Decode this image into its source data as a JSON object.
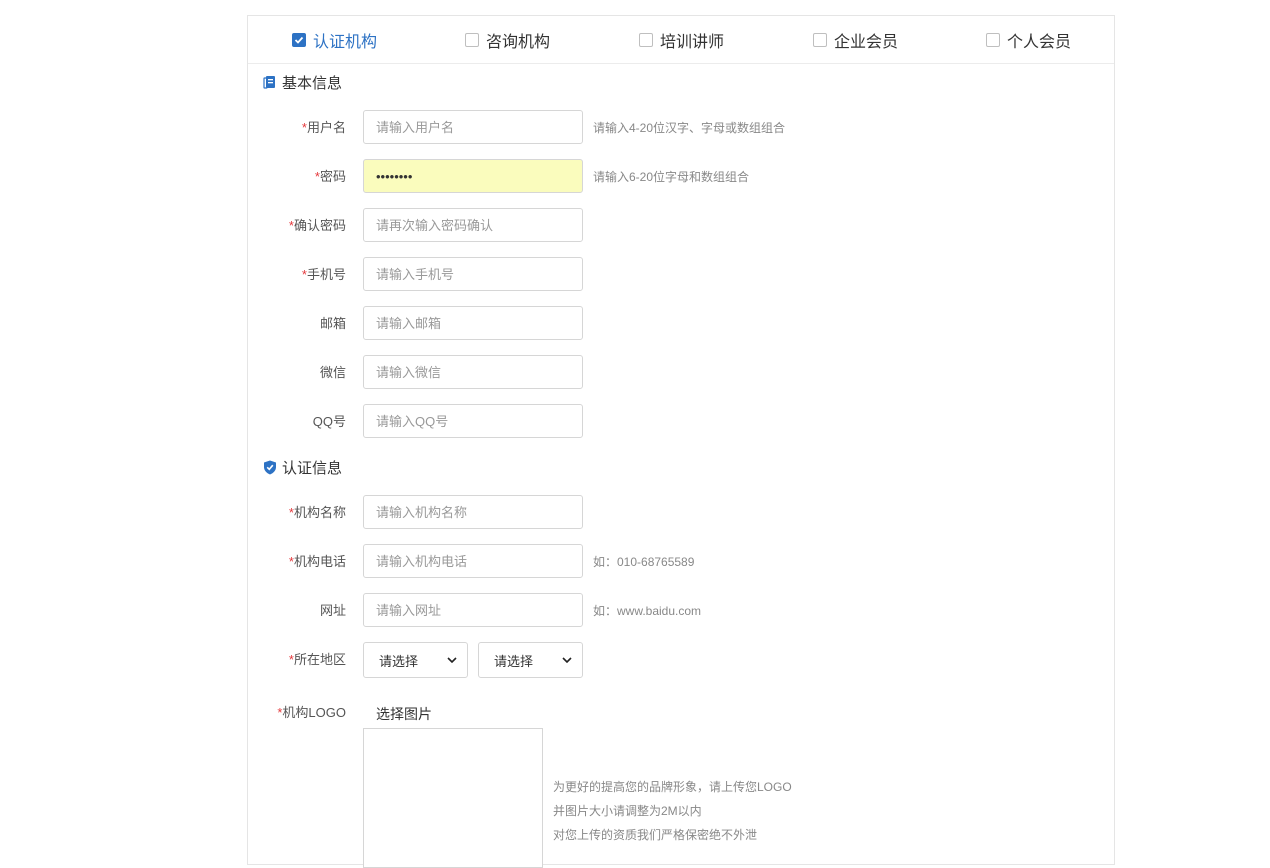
{
  "member_types": [
    {
      "label": "认证机构",
      "checked": true
    },
    {
      "label": "咨询机构",
      "checked": false
    },
    {
      "label": "培训讲师",
      "checked": false
    },
    {
      "label": "企业会员",
      "checked": false
    },
    {
      "label": "个人会员",
      "checked": false
    }
  ],
  "basic": {
    "title": "基本信息",
    "username": {
      "label": "用户名",
      "placeholder": "请输入用户名",
      "hint": "请输入4-20位汉字、字母或数组组合"
    },
    "password": {
      "label": "密码",
      "value": "••••••••",
      "hint": "请输入6-20位字母和数组组合"
    },
    "confirm": {
      "label": "确认密码",
      "placeholder": "请再次输入密码确认"
    },
    "phone": {
      "label": "手机号",
      "placeholder": "请输入手机号"
    },
    "email": {
      "label": "邮箱",
      "placeholder": "请输入邮箱"
    },
    "wechat": {
      "label": "微信",
      "placeholder": "请输入微信"
    },
    "qq": {
      "label": "QQ号",
      "placeholder": "请输入QQ号"
    }
  },
  "cert": {
    "title": "认证信息",
    "org_name": {
      "label": "机构名称",
      "placeholder": "请输入机构名称"
    },
    "org_phone": {
      "label": "机构电话",
      "placeholder": "请输入机构电话",
      "hint": "如：010-68765589"
    },
    "website": {
      "label": "网址",
      "placeholder": "请输入网址",
      "hint": "如：www.baidu.com"
    },
    "region": {
      "label": "所在地区",
      "select1": "请选择",
      "select2": "请选择"
    },
    "logo": {
      "label": "机构LOGO",
      "pick": "选择图片",
      "notes": [
        "为更好的提高您的品牌形象，请上传您LOGO",
        "并图片大小请调整为2M以内",
        "对您上传的资质我们严格保密绝不外泄"
      ]
    }
  },
  "required_mark": "*",
  "colors": {
    "accent": "#2d72c4",
    "required": "#e4393c",
    "autofill": "#fafcbd"
  }
}
